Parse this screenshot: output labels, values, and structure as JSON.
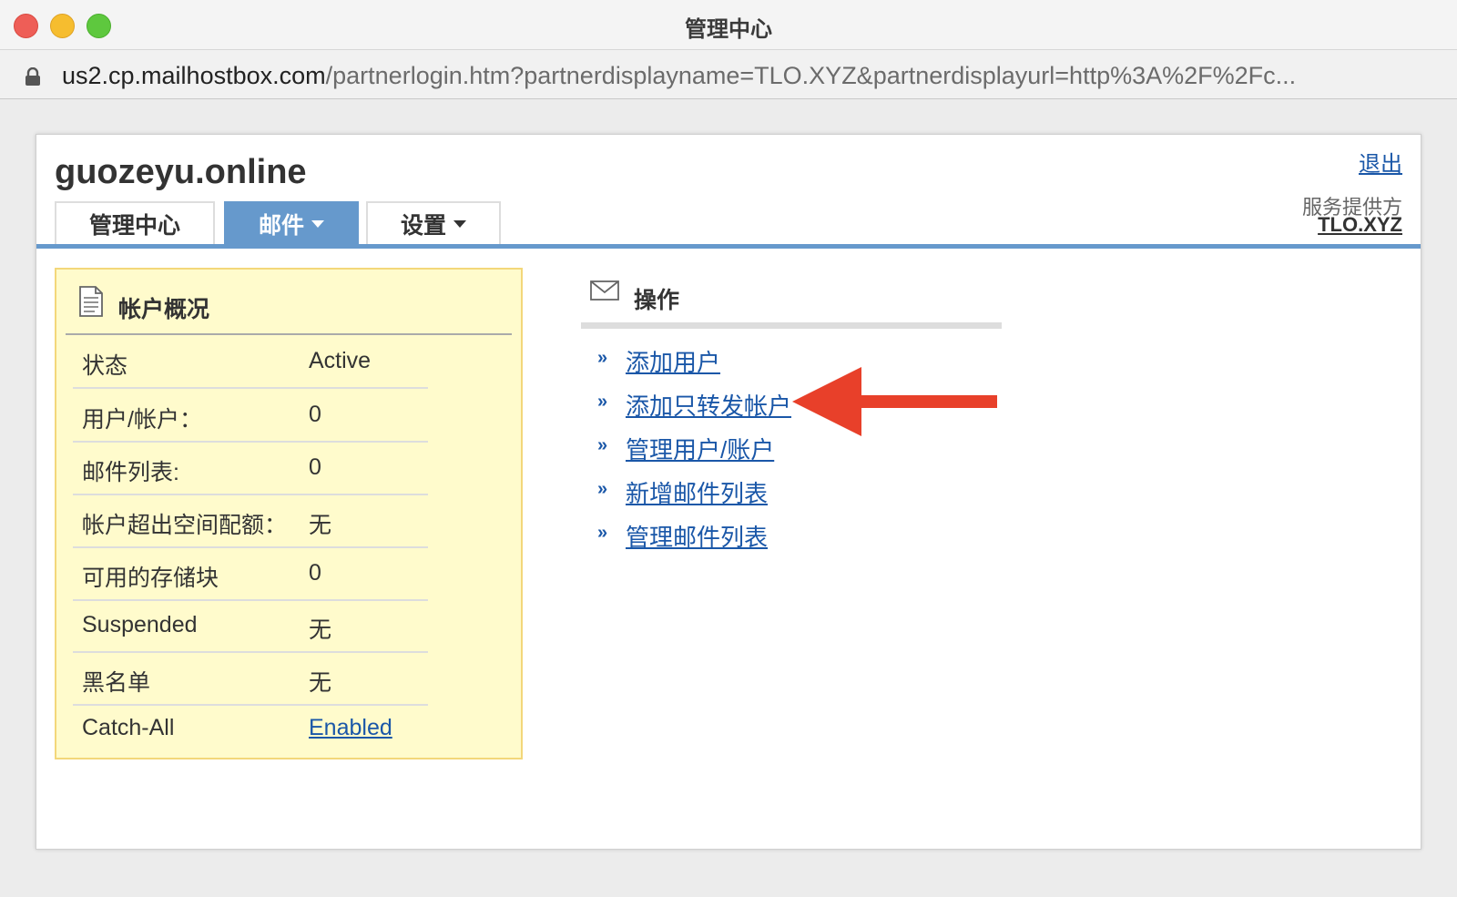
{
  "window": {
    "title": "管理中心",
    "url_host": "us2.cp.mailhostbox.com",
    "url_path": "/partnerlogin.htm?partnerdisplayname=TLO.XYZ&partnerdisplayurl=http%3A%2F%2Fc..."
  },
  "header": {
    "domain": "guozeyu.online",
    "logout": "退出",
    "provider_label": "服务提供方",
    "provider_name": "TLO.XYZ"
  },
  "tabs": [
    {
      "label": "管理中心",
      "active": false,
      "dropdown": false
    },
    {
      "label": "邮件",
      "active": true,
      "dropdown": true
    },
    {
      "label": "设置",
      "active": false,
      "dropdown": true
    }
  ],
  "overview": {
    "title": "帐户概况",
    "rows": [
      {
        "label": "状态",
        "value": "Active"
      },
      {
        "label": "用户/帐户：",
        "value": "0"
      },
      {
        "label": "邮件列表:",
        "value": "0"
      },
      {
        "label": "帐户超出空间配额：",
        "value": "无"
      },
      {
        "label": "可用的存储块",
        "value": "0"
      },
      {
        "label": "Suspended",
        "value": "无"
      },
      {
        "label": "黑名单",
        "value": "无"
      },
      {
        "label": "Catch-All",
        "value": "Enabled",
        "is_link": true
      }
    ]
  },
  "actions": {
    "title": "操作",
    "bullet": "»",
    "items": [
      {
        "label": "添加用户"
      },
      {
        "label": "添加只转发帐户",
        "highlighted": true
      },
      {
        "label": "管理用户/账户"
      },
      {
        "label": "新增邮件列表"
      },
      {
        "label": "管理邮件列表"
      }
    ]
  },
  "colors": {
    "nav_blue": "#6699cc",
    "link_blue": "#1a57a8",
    "panel_yellow": "#fffbcc",
    "panel_border": "#f3d77a",
    "annotation_red": "#e8402a"
  },
  "icons": {
    "lock": "lock-icon",
    "overview": "document-icon",
    "actions": "envelope-icon",
    "annotation": "red-arrow-icon"
  }
}
